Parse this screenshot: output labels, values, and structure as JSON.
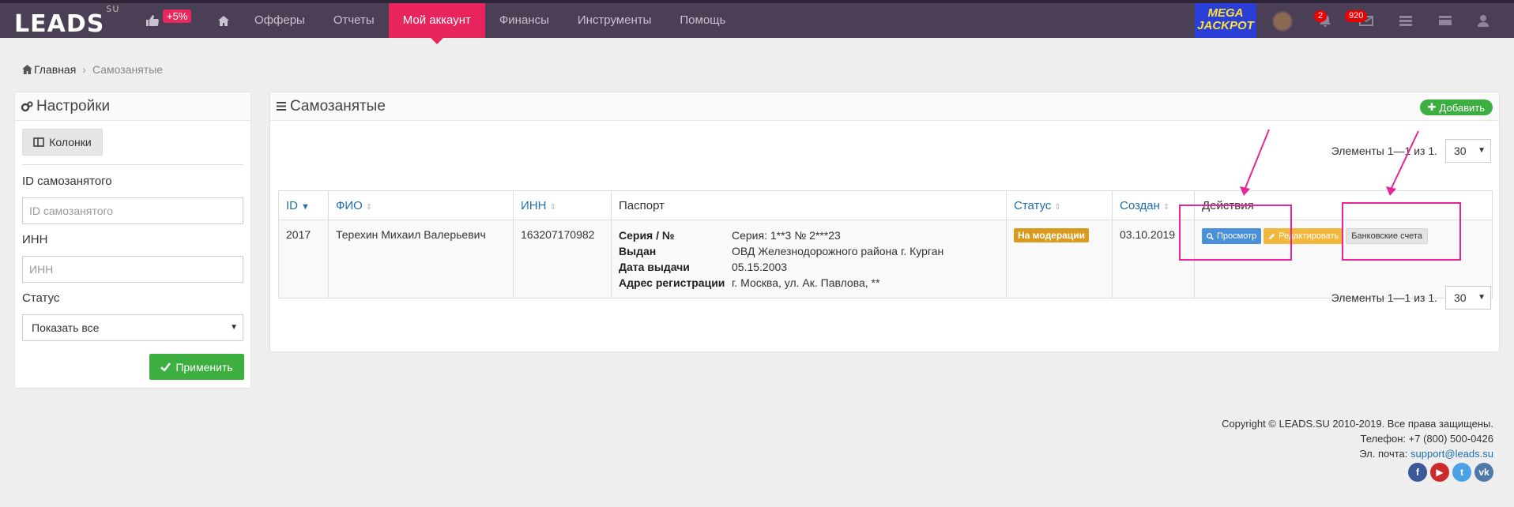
{
  "topbar": {
    "logo": "LEADS",
    "logo_suffix": "SU",
    "promo_badge": "+5%",
    "nav": [
      {
        "label": "Офферы"
      },
      {
        "label": "Отчеты"
      },
      {
        "label": "Мой аккаунт",
        "active": true
      },
      {
        "label": "Финансы"
      },
      {
        "label": "Инструменты"
      },
      {
        "label": "Помощь"
      }
    ],
    "jackpot_line1": "MEGA",
    "jackpot_line2": "JACKPOT",
    "notifications_count": "2",
    "messages_count": "920"
  },
  "breadcrumb": {
    "home": "Главная",
    "current": "Самозанятые"
  },
  "settings": {
    "title": "Настройки",
    "columns_button": "Колонки",
    "id_label": "ID самозанятого",
    "id_placeholder": "ID самозанятого",
    "inn_label": "ИНН",
    "inn_placeholder": "ИНН",
    "status_label": "Статус",
    "status_value": "Показать все",
    "apply_button": "Применить"
  },
  "main": {
    "title": "Самозанятые",
    "add_button": "Добавить",
    "pager_text": "Элементы 1—1 из 1.",
    "page_size": "30",
    "columns": {
      "id": "ID",
      "fio": "ФИО",
      "inn": "ИНН",
      "passport": "Паспорт",
      "status": "Статус",
      "created": "Создан",
      "actions": "Действия"
    },
    "rows": [
      {
        "id": "2017",
        "fio": "Терехин Михаил Валерьевич",
        "inn": "163207170982",
        "passport": {
          "series_label": "Серия / №",
          "series_value": "Серия: 1**3 № 2***23",
          "issued_label": "Выдан",
          "issued_value": "ОВД Железнодорожного района г. Курган",
          "date_label": "Дата выдачи",
          "date_value": "05.15.2003",
          "address_label": "Адрес регистрации",
          "address_value": "г. Москва, ул. Ак. Павлова, **"
        },
        "status": "На модерации",
        "created": "03.10.2019",
        "actions": {
          "view": "Просмотр",
          "edit": "Редактировать",
          "bank": "Банковские счета"
        }
      }
    ]
  },
  "footer": {
    "copyright": "Copyright © LEADS.SU 2010-2019. Все права защищены.",
    "phone": "Телефон: +7 (800) 500-0426",
    "email_label": "Эл. почта:",
    "email": "support@leads.su"
  },
  "colors": {
    "topbar": "#4a3f54",
    "active_nav": "#e8245d",
    "success": "#3daf41",
    "link": "#1f6fae",
    "status_moderation": "#d99a1e",
    "highlight": "#e8249a"
  }
}
